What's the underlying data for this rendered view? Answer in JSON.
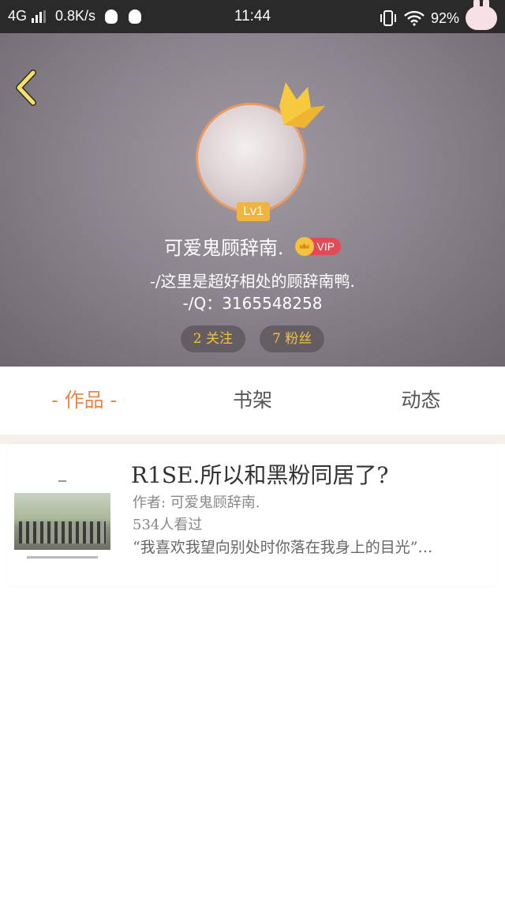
{
  "status_bar": {
    "network": "4G",
    "speed": "0.8K/s",
    "time": "11:44",
    "battery": "92%",
    "icons": [
      "signal-icon",
      "qq-icon",
      "qq-icon",
      "vibrate-icon",
      "wifi-icon",
      "bunny-icon"
    ]
  },
  "profile": {
    "level": "Lv1",
    "username": "可爱鬼顾辞南.",
    "vip_label": "VIP",
    "bio_line1": "-/这里是超好相处的顾辞南鸭.",
    "bio_line2": "-/Q：3165548258",
    "following": "2 关注",
    "followers": "7 粉丝"
  },
  "tabs": [
    {
      "label": "- 作品 -",
      "active": true
    },
    {
      "label": "书架",
      "active": false
    },
    {
      "label": "动态",
      "active": false
    }
  ],
  "works": [
    {
      "title": "R1SE.所以和黑粉同居了?",
      "author": "作者: 可爱鬼顾辞南.",
      "views": "534人看过",
      "excerpt": "“我喜欢我望向别处时你落在我身上的目光”…"
    }
  ],
  "colors": {
    "accent": "#e8874d",
    "pill_text": "#f2c23b",
    "vip": "#e24b56",
    "level_badge": "#f1b43e",
    "status_bar": "#2a2a2a"
  }
}
